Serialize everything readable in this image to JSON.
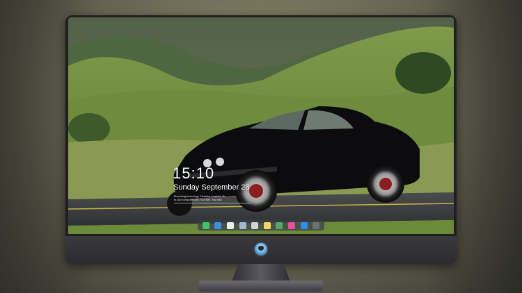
{
  "lock_screen": {
    "time": "15:10",
    "date": "Sunday September 28",
    "notice_line1": "Pioneering technology. Elevating creativity. Mo",
    "notice_line2": "to your computer story. Your files. Your disk"
  },
  "dock": {
    "items": [
      {
        "name": "messages-icon",
        "color": "#3fc46a"
      },
      {
        "name": "mail-icon",
        "color": "#3b8fe0"
      },
      {
        "name": "safari-icon",
        "color": "#e9eef3"
      },
      {
        "name": "finder-icon",
        "color": "#9fb9d6"
      },
      {
        "name": "clapper-icon",
        "color": "#d0d4da"
      },
      {
        "name": "notes-icon",
        "color": "#f3d36a"
      },
      {
        "name": "photos-icon",
        "color": "#58a56c"
      },
      {
        "name": "music-icon",
        "color": "#e84f9a"
      },
      {
        "name": "app-store-icon",
        "color": "#2f8cf0"
      },
      {
        "name": "settings-icon",
        "color": "#6e7077"
      }
    ]
  },
  "colors": {
    "bezel": "#1f1f22",
    "road": "#3c3e40",
    "grass": "#6f8f3a",
    "car_body": "#0c0c0e"
  }
}
